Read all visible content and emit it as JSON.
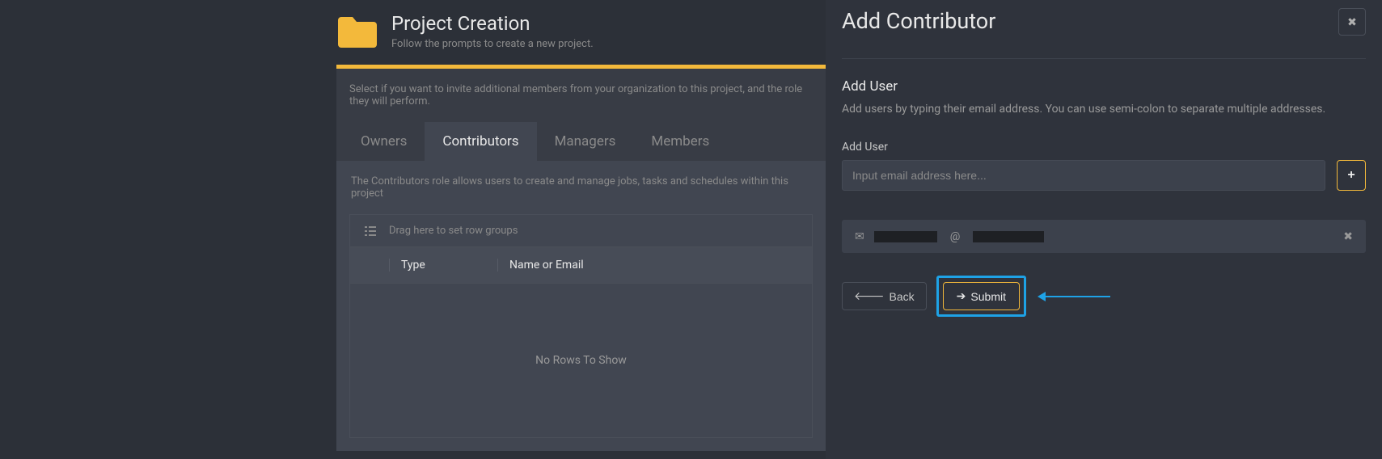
{
  "header": {
    "title": "Project Creation",
    "subtitle": "Follow the prompts to create a new project."
  },
  "invite_text": "Select if you want to invite additional members from your organization to this project, and the role they will perform.",
  "tabs": {
    "owners": "Owners",
    "contributors": "Contributors",
    "managers": "Managers",
    "members": "Members"
  },
  "role_desc": "The Contributors role allows users to create and manage jobs, tasks and schedules within this project",
  "table": {
    "row_group_hint": "Drag here to set row groups",
    "col_type": "Type",
    "col_name": "Name or Email",
    "empty": "No Rows To Show"
  },
  "panel": {
    "title": "Add Contributor",
    "section_title": "Add User",
    "section_desc": "Add users by typing their email address. You can use semi-colon to separate multiple addresses.",
    "field_label": "Add User",
    "input_placeholder": "Input email address here...",
    "chip_at": "@",
    "back_label": "Back",
    "submit_label": "Submit"
  }
}
